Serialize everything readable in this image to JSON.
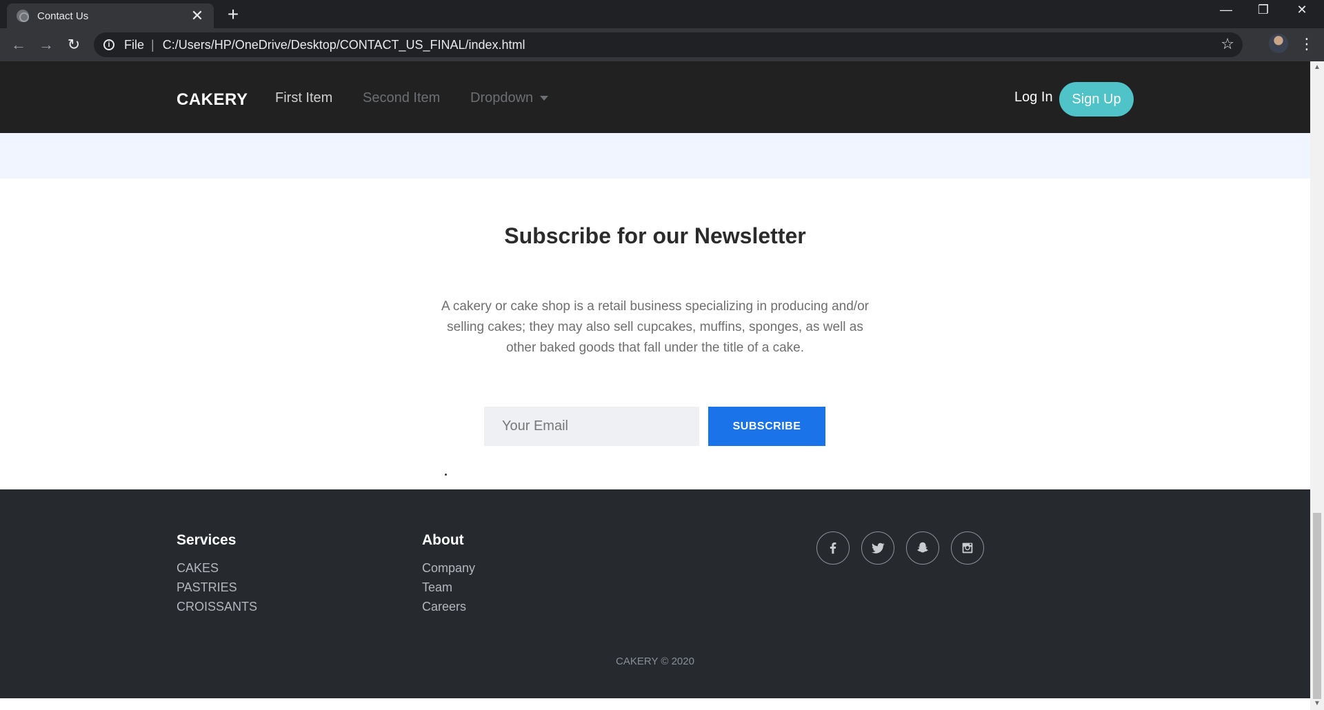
{
  "browser": {
    "tab_title": "Contact Us",
    "tab_close": "✕",
    "new_tab": "+",
    "scheme_label": "File",
    "separator": "|",
    "url": "C:/Users/HP/OneDrive/Desktop/CONTACT_US_FINAL/index.html",
    "window_controls": [
      "—",
      "❐",
      "✕"
    ],
    "nav_icons": [
      "arrow-back-icon",
      "arrow-forward-icon",
      "reload-icon",
      "info-icon",
      "star-icon",
      "kebab-menu-icon"
    ]
  },
  "nav": {
    "brand": "CAKERY",
    "items": [
      {
        "label": "First Item"
      },
      {
        "label": "Second Item"
      },
      {
        "label": "Dropdown"
      }
    ],
    "login_label": "Log In",
    "signup_label": "Sign Up"
  },
  "newsletter": {
    "title": "Subscribe for our Newsletter",
    "description": "A cakery or cake shop is a retail business specializing in producing and/or selling cakes; they may also sell cupcakes, muffins, sponges, as well as other baked goods that fall under the title of a cake.",
    "email_placeholder": "Your Email",
    "subscribe_label": "SUBSCRIBE"
  },
  "footer": {
    "services": {
      "heading": "Services",
      "items": [
        "CAKES",
        "PASTRIES",
        "CROISSANTS"
      ]
    },
    "about": {
      "heading": "About",
      "items": [
        "Company",
        "Team",
        "Careers"
      ]
    },
    "social_icons": [
      "facebook-icon",
      "twitter-icon",
      "snapchat-icon",
      "instagram-icon"
    ],
    "copyright": "CAKERY © 2020"
  },
  "colors": {
    "nav_bg": "#212121",
    "signup_accent": "#4fc3c8",
    "subscribe_accent": "#1a73e8",
    "band_bg": "#f0f5ff",
    "footer_bg": "#262a2e"
  }
}
